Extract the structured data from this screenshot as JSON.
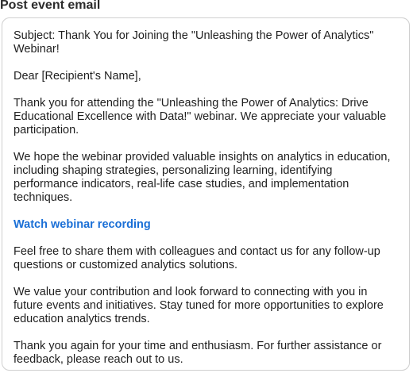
{
  "section": {
    "title": "Post event email"
  },
  "email": {
    "subject": "Subject: Thank You for Joining the \"Unleashing the Power of Analytics\" Webinar!",
    "greeting": "Dear [Recipient's Name],",
    "paragraphs": [
      "Thank you for attending the \"Unleashing the Power of Analytics: Drive Educational Excellence with Data!\" webinar. We appreciate your valuable participation.",
      "We hope the webinar provided valuable insights on analytics in education, including shaping strategies, personalizing learning, identifying performance indicators, real-life case studies, and implementation techniques."
    ],
    "link_label": "Watch webinar recording",
    "closing_paragraphs": [
      "Feel free to share them with colleagues and contact us for any follow-up questions or customized analytics solutions.",
      "We value your contribution and look forward to connecting with you in future events and initiatives. Stay tuned for more opportunities to explore education analytics trends.",
      "Thank you again for your time and enthusiasm. For further assistance or feedback, please reach out to us."
    ]
  },
  "colors": {
    "link": "#1a6fd6",
    "border": "#cfcfcf",
    "text": "#1f1f1f"
  }
}
